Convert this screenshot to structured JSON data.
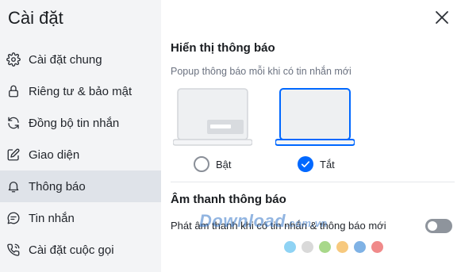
{
  "sidebar": {
    "title": "Cài đặt",
    "items": [
      {
        "label": "Cài đặt chung",
        "icon": "gear-icon"
      },
      {
        "label": "Riêng tư & bảo mật",
        "icon": "lock-icon"
      },
      {
        "label": "Đồng bộ tin nhắn",
        "icon": "sync-icon"
      },
      {
        "label": "Giao diện",
        "icon": "edit-icon"
      },
      {
        "label": "Thông báo",
        "icon": "bell-icon",
        "active": true
      },
      {
        "label": "Tin nhắn",
        "icon": "chat-icon"
      },
      {
        "label": "Cài đặt cuộc gọi",
        "icon": "phone-icon"
      }
    ]
  },
  "notification_display": {
    "title": "Hiển thị thông báo",
    "description": "Popup thông báo mỗi khi có tin nhắn mới",
    "option_on": "Bật",
    "option_off": "Tắt",
    "selected": "Tắt"
  },
  "notification_sound": {
    "title": "Âm thanh thông báo",
    "toggle_label": "Phát âm thanh khi có tin nhắn & thông báo mới",
    "enabled": false
  },
  "watermark": {
    "text": "Download",
    "suffix": ".com.vn",
    "dot_colors": [
      "#8fd3f4",
      "#d9d9d9",
      "#a8d88a",
      "#f7c97e",
      "#7fb2e5",
      "#f08a8a"
    ]
  },
  "colors": {
    "accent": "#0068ff",
    "sidebar_bg": "#f3f4f6",
    "active_bg": "#dfe3e9"
  }
}
